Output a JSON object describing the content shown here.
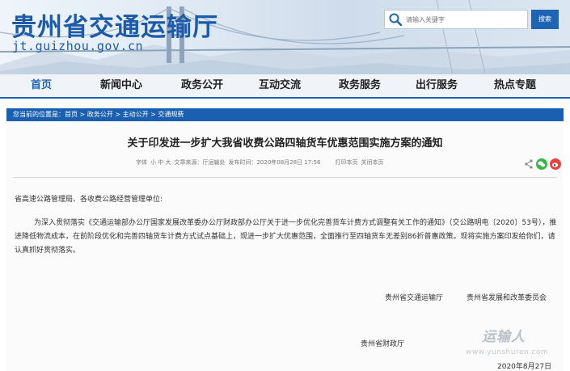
{
  "header": {
    "site_name": "贵州省交通运输厅",
    "site_url": "jt.guizhou.gov.cn",
    "search": {
      "placeholder": "请输入关键字",
      "button_label": "搜索"
    }
  },
  "nav": {
    "items": [
      "首页",
      "新闻中心",
      "政务公开",
      "互动交流",
      "政务服务",
      "出行服务",
      "热点专题"
    ],
    "active_index": 0
  },
  "breadcrumb": {
    "prefix": "您当前的位置是：",
    "items": [
      "首页",
      "政务公开",
      "主动公开",
      "交通规费"
    ],
    "separator": " > "
  },
  "article": {
    "title": "关于印发进一步扩大我省收费公路四轴货车优惠范围实施方案的通知",
    "meta": {
      "font_label": "字体",
      "font_sizes": "小 中 大",
      "source": "文章来源：厅运输处",
      "time": "发布时间：2020年08月28日 17:56",
      "print": "打印本页",
      "close": "关闭本页"
    },
    "salutation": "省高速公路管理局、各收费公路经营管理单位:",
    "paragraph": "为深入贯彻落实《交通运输部办公厅国家发展改革委办公厅财政部办公厅关于进一步优化完善货车计费方式调整有关工作的通知》（交公路明电〔2020〕53号），推进降低物流成本，在前阶段优化和完善四轴货车计费方式试点基础上，现进一步扩大优惠范围，全面推行至四轴货车无差别86折普惠政策。现将实施方案印发给你们，请认真抓好贯彻落实。",
    "signatories": [
      "贵州省交通运输厅",
      "贵州省发展和改革委员会",
      "贵州省财政厅"
    ],
    "date": "2020年8月27日"
  },
  "watermark": {
    "brand": "运输人",
    "url": "www.yunshuren.com"
  },
  "colors": {
    "brand_blue": "#1f63b3",
    "crumb_blue": "#1a5fb0",
    "wechat_green": "#3bb54a",
    "weibo_red": "#e64340"
  }
}
